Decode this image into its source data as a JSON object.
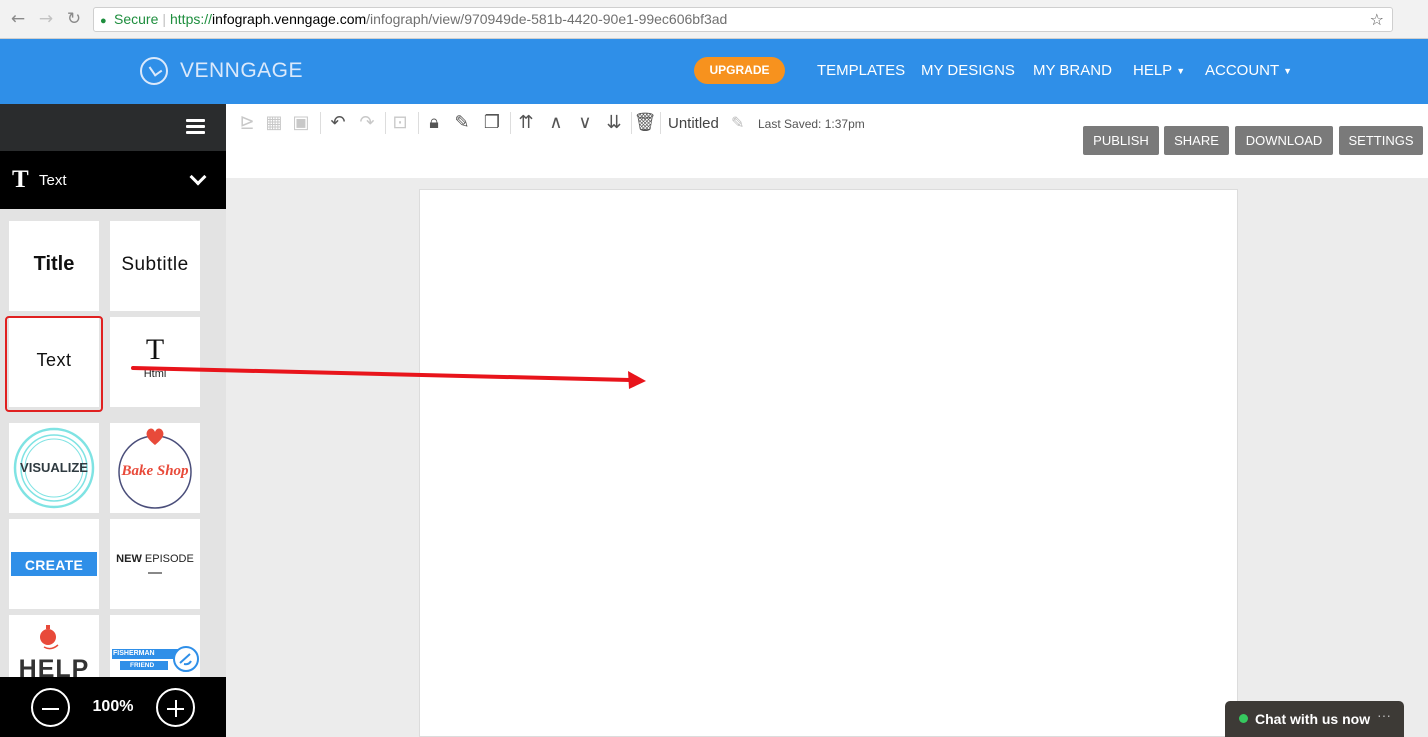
{
  "browser": {
    "back": "←",
    "forward": "→",
    "reload": "↻",
    "secure_label": "Secure",
    "url_scheme": "https://",
    "url_host": "infograph.venngage.com",
    "url_path": "/infograph/view/970949de-581b-4420-90e1-99ec606bf3ad",
    "star": "☆"
  },
  "header": {
    "logo_text": "VENNGAGE",
    "upgrade_label": "UPGRADE",
    "nav": {
      "templates": "TEMPLATES",
      "my_designs": "MY DESIGNS",
      "my_brand": "MY BRAND",
      "help": "HELP",
      "account": "ACCOUNT"
    },
    "brand_color": "#2f8fe8",
    "upgrade_color": "#f7921e"
  },
  "sidebar": {
    "section_icon": "T",
    "section_label": "Text",
    "tiles": {
      "title": "Title",
      "subtitle": "Subtitle",
      "text": "Text",
      "html_icon": "T",
      "html": "Html",
      "visualize": "VISUALIZE",
      "bake_shop": "Bake Shop",
      "create": "CREATE",
      "new_episode_a": "NEW",
      "new_episode_b": "EPISODE",
      "help": "HELP",
      "fisherman_a": "FISHERMAN",
      "fisherman_b": "FRIEND"
    },
    "zoom_level": "100%"
  },
  "toolbar": {
    "doc_title": "Untitled",
    "last_saved": "Last Saved: 1:37pm",
    "publish": "PUBLISH",
    "share": "SHARE",
    "download": "DOWNLOAD",
    "settings": "SETTINGS"
  },
  "chat": {
    "label": "Chat with us now",
    "more": "···"
  }
}
